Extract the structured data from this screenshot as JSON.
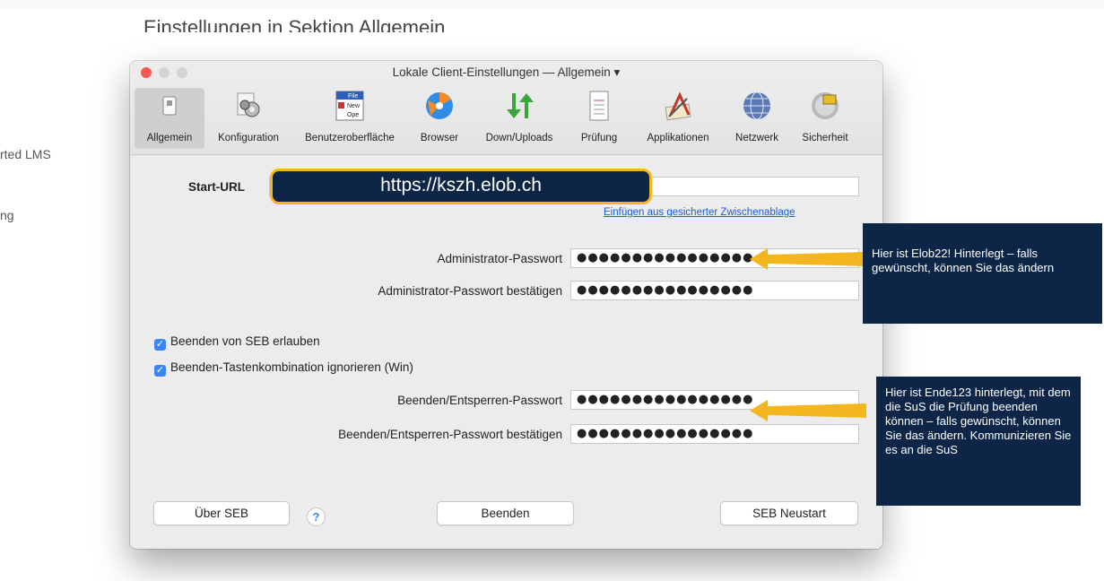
{
  "page": {
    "heading": "Einstellungen in Sektion Allgemein",
    "side_texts": [
      "rted LMS",
      "ng"
    ]
  },
  "window": {
    "title": "Lokale Client-Einstellungen  —  Allgemein ▾",
    "traffic_colors": [
      "#fc5753",
      "#d4d4d4",
      "#d4d4d4"
    ]
  },
  "toolbar": {
    "items": [
      {
        "label": "Allgemein",
        "icon": "general-switch-icon",
        "selected": true
      },
      {
        "label": "Konfiguration",
        "icon": "gears-icon"
      },
      {
        "label": "Benutzeroberfläche",
        "icon": "file-menu-icon"
      },
      {
        "label": "Browser",
        "icon": "browser-icon"
      },
      {
        "label": "Down/Uploads",
        "icon": "download-upload-arrows-icon"
      },
      {
        "label": "Prüfung",
        "icon": "exam-document-icon"
      },
      {
        "label": "Applikationen",
        "icon": "applications-icon"
      },
      {
        "label": "Netzwerk",
        "icon": "network-globe-icon"
      },
      {
        "label": "Sicherheit",
        "icon": "security-lock-icon"
      }
    ],
    "file_icon_text": {
      "top": "File",
      "line2": "New",
      "line3": "Ope"
    }
  },
  "form": {
    "start_url_label": "Start-URL",
    "start_url_value": "https://kszh.elob.ch",
    "paste_link": "Einfügen aus gesicherter Zwischenablage",
    "admin_pw_label": "Administrator-Passwort",
    "admin_pw_value": "●●●●●●●●●●●●●●●●",
    "admin_pw_confirm_label": "Administrator-Passwort bestätigen",
    "admin_pw_confirm_value": "●●●●●●●●●●●●●●●●",
    "allow_quit_label": "Beenden von SEB erlauben",
    "ignore_keys_label": "Beenden-Tastenkombination ignorieren (Win)",
    "quit_pw_label": "Beenden/Entsperren-Passwort",
    "quit_pw_value": "●●●●●●●●●●●●●●●●",
    "quit_pw_confirm_label": "Beenden/Entsperren-Passwort bestätigen",
    "quit_pw_confirm_value": "●●●●●●●●●●●●●●●●"
  },
  "buttons": {
    "about": "Über SEB",
    "help": "?",
    "quit": "Beenden",
    "restart": "SEB Neustart"
  },
  "callouts": {
    "admin": "Hier ist Elob22! Hinterlegt – falls gewünscht, können Sie das ändern",
    "quit": "Hier ist Ende123 hinterlegt, mit dem die SuS die Prüfung beenden können – falls gewünscht, können Sie das ändern. Kommunizieren Sie es an die SuS"
  },
  "colors": {
    "accent": "#3b86f7",
    "callout_bg": "#0d2648",
    "arrow": "#f3b61f"
  }
}
